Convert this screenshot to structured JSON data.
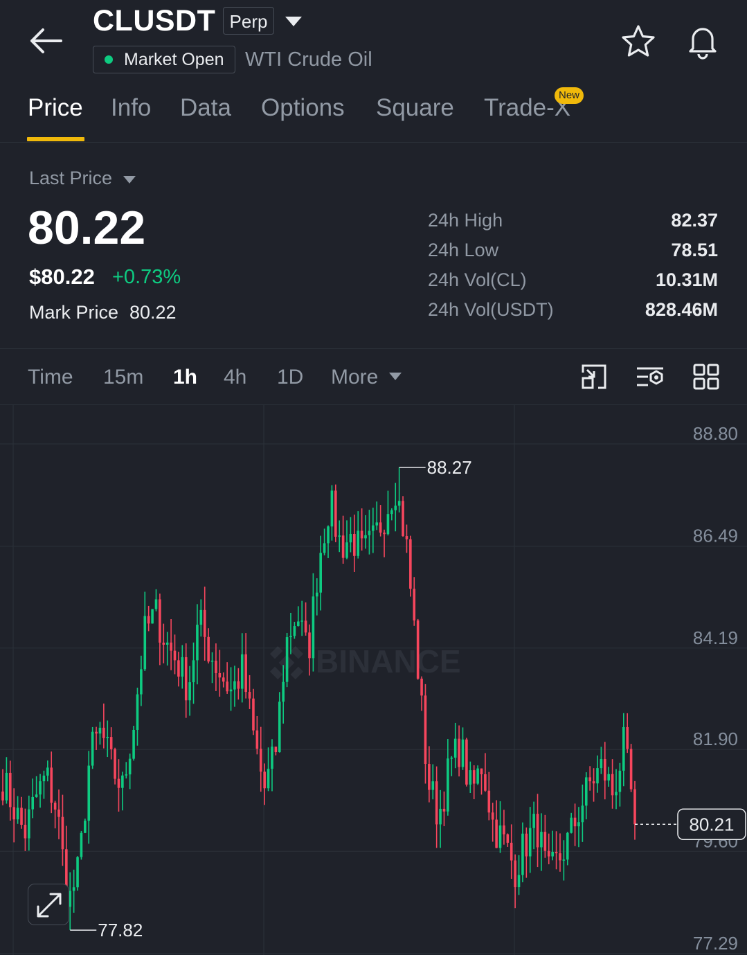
{
  "header": {
    "symbol": "CLUSDT",
    "contract_type": "Perp",
    "market_status": "Market Open",
    "instrument_name": "WTI Crude Oil"
  },
  "tabs": [
    {
      "label": "Price",
      "active": true
    },
    {
      "label": "Info"
    },
    {
      "label": "Data"
    },
    {
      "label": "Options"
    },
    {
      "label": "Square"
    },
    {
      "label": "Trade-X",
      "badge": "New"
    }
  ],
  "price": {
    "label": "Last Price",
    "last": "80.22",
    "usd": "$80.22",
    "change": "+0.73%",
    "mark_label": "Mark Price",
    "mark_value": "80.22"
  },
  "stats": [
    {
      "label": "24h High",
      "value": "82.37"
    },
    {
      "label": "24h Low",
      "value": "78.51"
    },
    {
      "label": "24h Vol(CL)",
      "value": "10.31M"
    },
    {
      "label": "24h Vol(USDT)",
      "value": "828.46M"
    }
  ],
  "intervals": {
    "items": [
      "Time",
      "15m",
      "1h",
      "4h",
      "1D"
    ],
    "active": "1h",
    "more": "More"
  },
  "colors": {
    "up": "#0ecb81",
    "down": "#f6465d",
    "accent": "#f0b90b",
    "bg": "#1f222a"
  },
  "chart": {
    "y_ticks": [
      "88.80",
      "86.49",
      "84.19",
      "81.90",
      "79.60",
      "77.29"
    ],
    "high_label": "88.27",
    "low_label": "77.82",
    "current_label": "80.21",
    "watermark": "BINANCE"
  },
  "chart_data": {
    "type": "candlestick",
    "ylim": [
      77.29,
      88.8
    ],
    "y_ticks": [
      88.8,
      86.49,
      84.19,
      81.9,
      79.6,
      77.29
    ],
    "high": 88.27,
    "low": 77.82,
    "current": 80.21,
    "close_path": [
      81.2,
      80.6,
      80.0,
      80.8,
      81.3,
      80.5,
      78.4,
      79.2,
      81.8,
      82.3,
      81.5,
      81.0,
      82.5,
      84.5,
      85.0,
      84.3,
      83.9,
      83.3,
      84.8,
      84.1,
      83.6,
      83.2,
      83.7,
      82.2,
      81.0,
      81.8,
      84.3,
      85.0,
      84.0,
      86.2,
      87.5,
      86.5,
      86.7,
      86.3,
      86.6,
      87.2,
      87.9,
      86.6,
      84.0,
      81.2,
      80.4,
      81.5,
      82.0,
      80.9,
      81.6,
      80.2,
      79.8,
      79.2,
      79.8,
      80.2,
      79.0,
      79.4,
      79.9,
      80.6,
      81.2,
      81.5,
      80.9,
      82.0,
      80.3
    ]
  }
}
